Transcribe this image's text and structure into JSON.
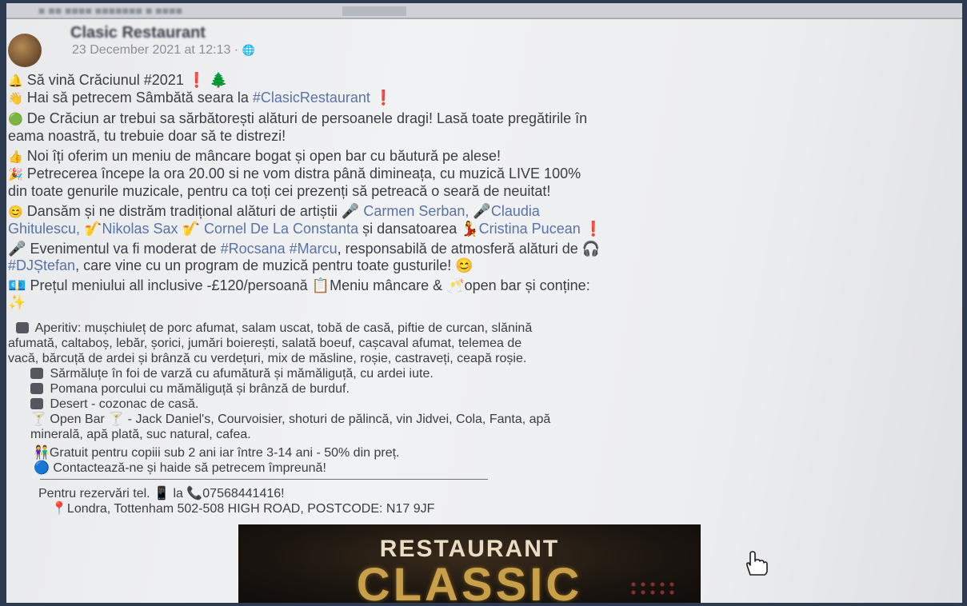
{
  "header": {
    "page_name": "Clasic Restaurant",
    "date": "23 December 2021 at 12:13 · ",
    "globe_icon": "globe-icon"
  },
  "post": {
    "l1": "Să vină Crăciunul #2021",
    "l2_pre": "Hai să petrecem Sâmbătă seara la ",
    "l2_tag": "#ClasicRestaurant",
    "l3": "De Crăciun ar trebui sa sărbătorești alături de persoanele dragi! Lasă toate pregătirile în",
    "l4": "eama noastră, tu trebuie doar să te distrezi!",
    "l5": "Noi îți oferim un meniu de mâncare bogat și open bar cu băutură pe alese!",
    "l6": "Petrecerea începe la ora 20.00 si ne vom distra până dimineața, cu muzică LIVE 100%",
    "l7": "din toate genurile muzicale, pentru ca toți cei prezenți să petreacă o seară de neuitat!",
    "l8_pre": "Dansăm și ne distrăm tradițional alături de artiștii",
    "a1": "Carmen Serban,",
    "a2": "Claudia",
    "a2b": "Ghitulescu,",
    "a3": "Nikolas Sax",
    "a4": "Cornel De La Constanta",
    "l9_mid": "și dansatoarea",
    "a5": "Cristina Pucean",
    "l10_pre": "Evenimentul va fi moderat de ",
    "l10_tag": "#Rocsana #Marcu",
    "l10_post": ", responsabilă de atmosferă alături de",
    "l11_tag": "#DJȘtefan",
    "l11_post": ", care vine cu un program de muzică pentru toate gusturile!",
    "l12_a": "Prețul meniului all inclusive -£120/persoană",
    "l12_b": "Meniu mâncare &",
    "l12_c": "open bar și conține:",
    "m1": "Aperitiv: mușchiuleț de porc afumat, salam uscat, tobă de casă, piftie de curcan, slănină",
    "m1b": "afumată, caltaboș, lebăr, șorici, jumări boierești, salată boeuf, cașcaval afumat, telemea de",
    "m1c": "vacă, bărcuță de ardei și brânză cu verdețuri, mix de măsline, roșie, castraveți, ceapă roșie.",
    "m2": "Sărmăluțe în foi de varză cu afumătură și mămăliguță, cu ardei iute.",
    "m3": "Pomana porcului cu mămăliguță și brânză de burduf.",
    "m4": "Desert - cozonac de casă.",
    "m5": "Open Bar",
    "m5b": " - Jack Daniel's, Courvoisier, shoturi de pălincă, vin Jidvei, Cola, Fanta, apă",
    "m5c": "minerală, apă plată, suc natural, cafea.",
    "k1": "Gratuit pentru copiii sub 2 ani iar între 3-14 ani - 50% din preț.",
    "k2": "Contactează-ne și haide să petrecem împreună!",
    "c1_a": "Pentru rezervări tel.",
    "c1_b": "la",
    "c1_phone": "07568441416!",
    "c2": "Londra, Tottenham 502-508 HIGH ROAD, POSTCODE: N17 9JF"
  },
  "banner": {
    "line1": "RESTAURANT",
    "line2": "CLASSIC"
  },
  "icons": [
    "globe-icon",
    "bell-icon",
    "tree-icon",
    "microphone-icon",
    "saxophone-icon",
    "headphones-icon",
    "phone-icon",
    "pin-icon",
    "hand-cursor-icon"
  ]
}
